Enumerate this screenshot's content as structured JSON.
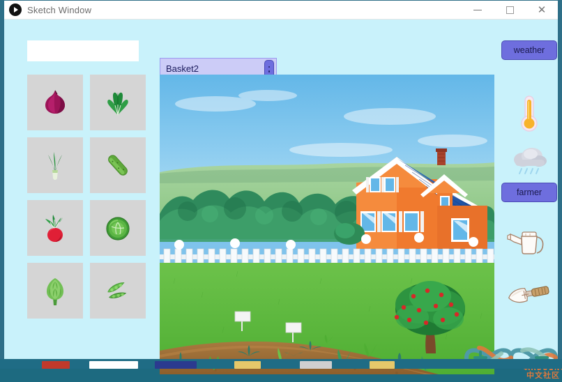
{
  "window": {
    "title": "Sketch Window",
    "app_icon": "play-circle-icon",
    "controls": {
      "minimize": "minimize-icon",
      "maximize": "maximize-icon",
      "close": "close-icon"
    }
  },
  "left_panel": {
    "name_field": {
      "value": "",
      "placeholder": ""
    },
    "vegetables": [
      {
        "name": "red-onion",
        "label": "Red Onion"
      },
      {
        "name": "spinach",
        "label": "Spinach"
      },
      {
        "name": "green-onion",
        "label": "Green Onion"
      },
      {
        "name": "cucumber",
        "label": "Cucumber"
      },
      {
        "name": "radish",
        "label": "Radish"
      },
      {
        "name": "cabbage",
        "label": "Cabbage"
      },
      {
        "name": "artichoke",
        "label": "Artichoke"
      },
      {
        "name": "pea-pods",
        "label": "Pea Pods"
      }
    ]
  },
  "basket_field": {
    "value": "Basket2",
    "handle": "vertical-drag-handle"
  },
  "right_panel": {
    "weather_button": "weather",
    "farmer_button": "farmer",
    "icons": [
      {
        "name": "thermometer-icon",
        "label": "Thermometer"
      },
      {
        "name": "rain-cloud-icon",
        "label": "Rain Cloud"
      },
      {
        "name": "watering-can-icon",
        "label": "Watering Can"
      },
      {
        "name": "trowel-icon",
        "label": "Garden Trowel"
      }
    ]
  },
  "stage": {
    "scene_name": "farm-scene",
    "elements": [
      "sky",
      "distant-hills",
      "tree-line",
      "white-picket-fence",
      "orange-house",
      "blue-roof",
      "brick-chimney",
      "lawn",
      "apple-tree",
      "garden-bed",
      "seedlings",
      "plant-sign-1",
      "plant-sign-2"
    ]
  },
  "watermark": {
    "brand": "ARDUINO",
    "subtitle": "中文社区"
  },
  "colors": {
    "client_bg": "#c9f2fb",
    "button_purple": "#6e6ede",
    "basket_field": "#ccccf7",
    "veg_cell": "#d5d5d5",
    "window_border": "#2e6f88"
  }
}
